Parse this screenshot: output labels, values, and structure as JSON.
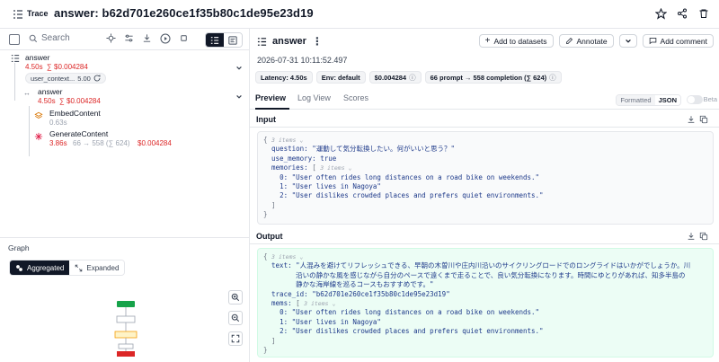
{
  "header": {
    "section_label": "Trace",
    "title": "answer: b62d701e260ce1f35b80c1de95e23d19"
  },
  "left": {
    "search_placeholder": "Search",
    "tree": [
      {
        "name": "answer",
        "latency": "4.50s",
        "cost": "$0.004284",
        "chip_label": "user_context...",
        "chip_value": "5.00"
      },
      {
        "name": "answer",
        "latency": "4.50s",
        "cost": "$0.004284"
      },
      {
        "name": "EmbedContent",
        "latency": "0.63s"
      },
      {
        "name": "GenerateContent",
        "latency": "3.86s",
        "tokens": "66 → 558 (∑ 624)",
        "cost": "$0.004284"
      }
    ],
    "graph": {
      "title": "Graph",
      "aggregated_label": "Aggregated",
      "expanded_label": "Expanded"
    }
  },
  "right": {
    "title": "answer",
    "actions": {
      "add_to_datasets": "Add to datasets",
      "annotate": "Annotate",
      "add_comment": "Add comment"
    },
    "timestamp": "2026-07-31 10:11:52.497",
    "badges": {
      "latency": "Latency: 4.50s",
      "env": "Env: default",
      "cost": "$0.004284",
      "tokens": "66 prompt → 558 completion (∑ 624)"
    },
    "tabs": [
      "Preview",
      "Log View",
      "Scores"
    ],
    "format": {
      "formatted": "Formatted",
      "json": "JSON",
      "beta": "Beta"
    },
    "input": {
      "label": "Input",
      "items_label": "3 items",
      "question_key": "question:",
      "question": "\"運動して気分転換したい。何がいいと思う？\"",
      "use_memory_key": "use_memory:",
      "use_memory": "true",
      "memories_key": "memories:",
      "memories": [
        "0: \"User often rides long distances on a road bike on weekends.\"",
        "1: \"User lives in Nagoya\"",
        "2: \"User dislikes crowded places and prefers quiet environments.\""
      ]
    },
    "output": {
      "label": "Output",
      "items_label": "3 items",
      "text_key": "text:",
      "text": "\"人混みを避けてリフレッシュできる、早朝の木曽川や庄内川沿いのサイクリングロードでのロングライドはいかがでしょうか。川沿いの静かな風を感じながら自分のペースで遠くまで走ることで、良い気分転換になります。時間にゆとりがあれば、知多半島の静かな海岸線を巡るコースもおすすめです。\"",
      "trace_id_key": "trace_id:",
      "trace_id": "\"b62d701e260ce1f35b80c1de95e23d19\"",
      "mems_key": "mems:",
      "mems": [
        "0: \"User often rides long distances on a road bike on weekends.\"",
        "1: \"User lives in Nagoya\"",
        "2: \"User dislikes crowded places and prefers quiet environments.\""
      ]
    }
  }
}
